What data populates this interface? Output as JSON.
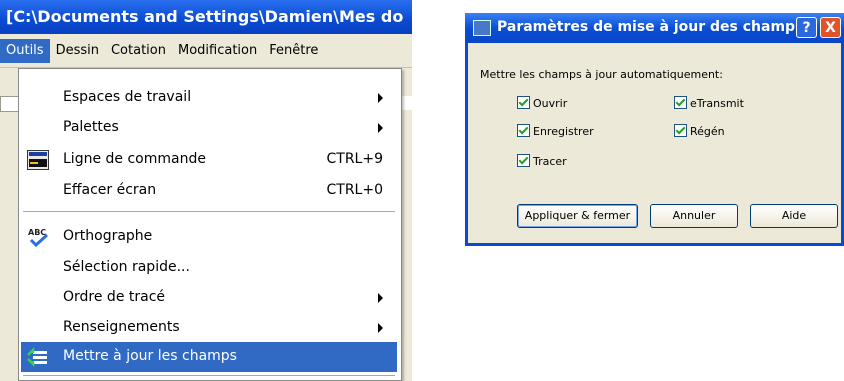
{
  "app": {
    "title": "[C:\\Documents and Settings\\Damien\\Mes do",
    "menus": [
      "Outils",
      "Dessin",
      "Cotation",
      "Modification",
      "Fenêtre"
    ],
    "active_menu": "Outils"
  },
  "dropdown": {
    "items": [
      {
        "label": "Espaces de travail",
        "submenu": true
      },
      {
        "label": "Palettes",
        "submenu": true
      },
      {
        "label": "Ligne de commande",
        "shortcut": "CTRL+9",
        "icon": "command-line-icon"
      },
      {
        "label": "Effacer écran",
        "shortcut": "CTRL+0"
      },
      {
        "label": "Orthographe",
        "icon": "spellcheck-icon"
      },
      {
        "label": "Sélection rapide..."
      },
      {
        "label": "Ordre de tracé",
        "submenu": true
      },
      {
        "label": "Renseignements",
        "submenu": true
      },
      {
        "label": "Mettre à jour les champs",
        "icon": "update-fields-icon",
        "highlighted": true
      }
    ]
  },
  "dialog": {
    "title": "Paramètres de mise à jour des champs",
    "help_glyph": "?",
    "close_glyph": "X",
    "instruction": "Mettre les champs à jour automatiquement:",
    "checkboxes": [
      {
        "label": "Ouvrir",
        "checked": true
      },
      {
        "label": "eTransmit",
        "checked": true
      },
      {
        "label": "Enregistrer",
        "checked": true
      },
      {
        "label": "Régén",
        "checked": true
      },
      {
        "label": "Tracer",
        "checked": true
      }
    ],
    "buttons": {
      "apply": "Appliquer & fermer",
      "cancel": "Annuler",
      "help": "Aide"
    }
  },
  "colors": {
    "titlebar": "#0a4ad0",
    "highlight": "#316ac5",
    "dialog_bg": "#ece9d8"
  }
}
